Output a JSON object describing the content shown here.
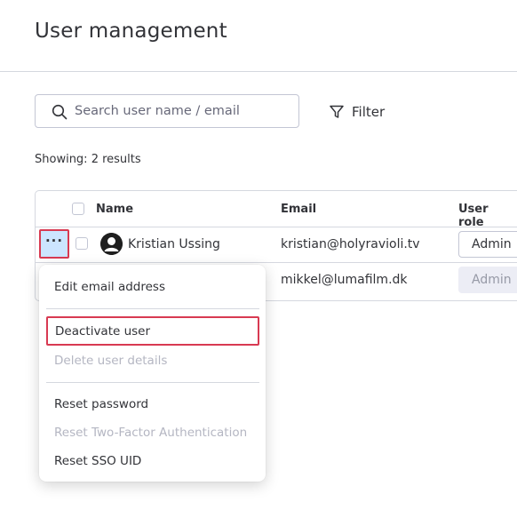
{
  "page": {
    "title": "User management"
  },
  "search": {
    "placeholder": "Search user name / email",
    "value": ""
  },
  "filter": {
    "label": "Filter"
  },
  "results": {
    "showing_text": "Showing: 2 results"
  },
  "table": {
    "headers": {
      "name": "Name",
      "email": "Email",
      "role": "User role"
    },
    "rows": [
      {
        "name": "Kristian Ussing",
        "email": "kristian@holyravioli.tv",
        "role": "Admin",
        "role_disabled": false
      },
      {
        "name": "",
        "email": "mikkel@lumafilm.dk",
        "role": "Admin",
        "role_disabled": true
      }
    ]
  },
  "row_actions": {
    "more_label": "···"
  },
  "context_menu": {
    "items": [
      {
        "label": "Edit email address",
        "enabled": true
      },
      {
        "label": "Deactivate user",
        "enabled": true,
        "highlighted": true
      },
      {
        "label": "Delete user details",
        "enabled": false
      },
      {
        "label": "Reset password",
        "enabled": true
      },
      {
        "label": "Reset Two-Factor Authentication",
        "enabled": false
      },
      {
        "label": "Reset SSO UID",
        "enabled": true
      }
    ]
  },
  "colors": {
    "text": "#323338",
    "border": "#d5d8df",
    "highlight_border": "#d83a52",
    "selected_bg": "#cce5ff",
    "disabled_text": "#b4b6c2"
  },
  "icons": {
    "search": "search-icon",
    "filter": "filter-icon",
    "more": "more-options-icon",
    "avatar": "user-avatar-icon"
  }
}
